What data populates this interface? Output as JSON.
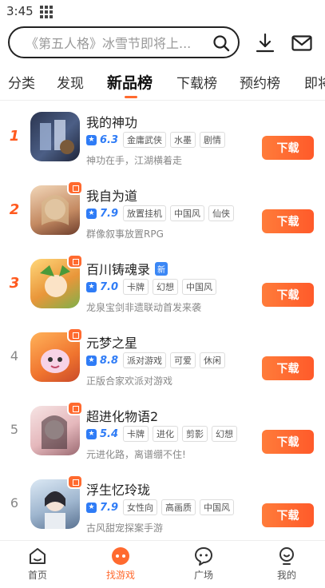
{
  "status": {
    "time": "3:45"
  },
  "search": {
    "placeholder": "《第五人格》冰雪节即将上..."
  },
  "tabs": [
    {
      "label": "分类"
    },
    {
      "label": "发现"
    },
    {
      "label": "新品榜"
    },
    {
      "label": "下载榜"
    },
    {
      "label": "预约榜"
    },
    {
      "label": "即将"
    }
  ],
  "active_tab": "新品榜",
  "games": [
    {
      "rank": "1",
      "name": "我的神功",
      "score": "6.3",
      "tags": [
        "金庸武侠",
        "水墨",
        "剧情"
      ],
      "desc": "神功在手，江湖横着走",
      "button": "下载",
      "new": false,
      "gift": false,
      "thumb_color": "#3a4a6a"
    },
    {
      "rank": "2",
      "name": "我自为道",
      "score": "7.9",
      "tags": [
        "放置挂机",
        "中国风",
        "仙侠"
      ],
      "desc": "群像叙事放置RPG",
      "button": "下载",
      "new": false,
      "gift": true,
      "thumb_color": "#c98a5a"
    },
    {
      "rank": "3",
      "name": "百川铸魂录",
      "score": "7.0",
      "tags": [
        "卡牌",
        "幻想",
        "中国风"
      ],
      "desc": "龙泉宝剑非遗联动首发来袭",
      "button": "下载",
      "new": true,
      "new_label": "新",
      "gift": true,
      "thumb_color": "#e0a640"
    },
    {
      "rank": "4",
      "name": "元梦之星",
      "score": "8.8",
      "tags": [
        "派对游戏",
        "可爱",
        "休闲"
      ],
      "desc": "正版合家欢派对游戏",
      "button": "下载",
      "new": false,
      "gift": true,
      "thumb_color": "#f08a3a"
    },
    {
      "rank": "5",
      "name": "超进化物语2",
      "score": "5.4",
      "tags": [
        "卡牌",
        "进化",
        "剪影",
        "幻想"
      ],
      "desc": "元进化路，离谱绷不住!",
      "button": "下载",
      "new": false,
      "gift": true,
      "thumb_color": "#e8c8c8"
    },
    {
      "rank": "6",
      "name": "浮生忆玲珑",
      "score": "7.9",
      "tags": [
        "女性向",
        "高画质",
        "中国风"
      ],
      "desc": "古风甜宠探案手游",
      "button": "下载",
      "new": false,
      "gift": true,
      "thumb_color": "#a8c0d8"
    }
  ],
  "bottom_nav": [
    {
      "label": "首页",
      "icon": "home-icon"
    },
    {
      "label": "找游戏",
      "icon": "game-controller-icon"
    },
    {
      "label": "广场",
      "icon": "chat-bubble-icon"
    },
    {
      "label": "我的",
      "icon": "profile-icon"
    }
  ],
  "colors": {
    "accent": "#ff6a2f",
    "score": "#2f7cf6"
  }
}
